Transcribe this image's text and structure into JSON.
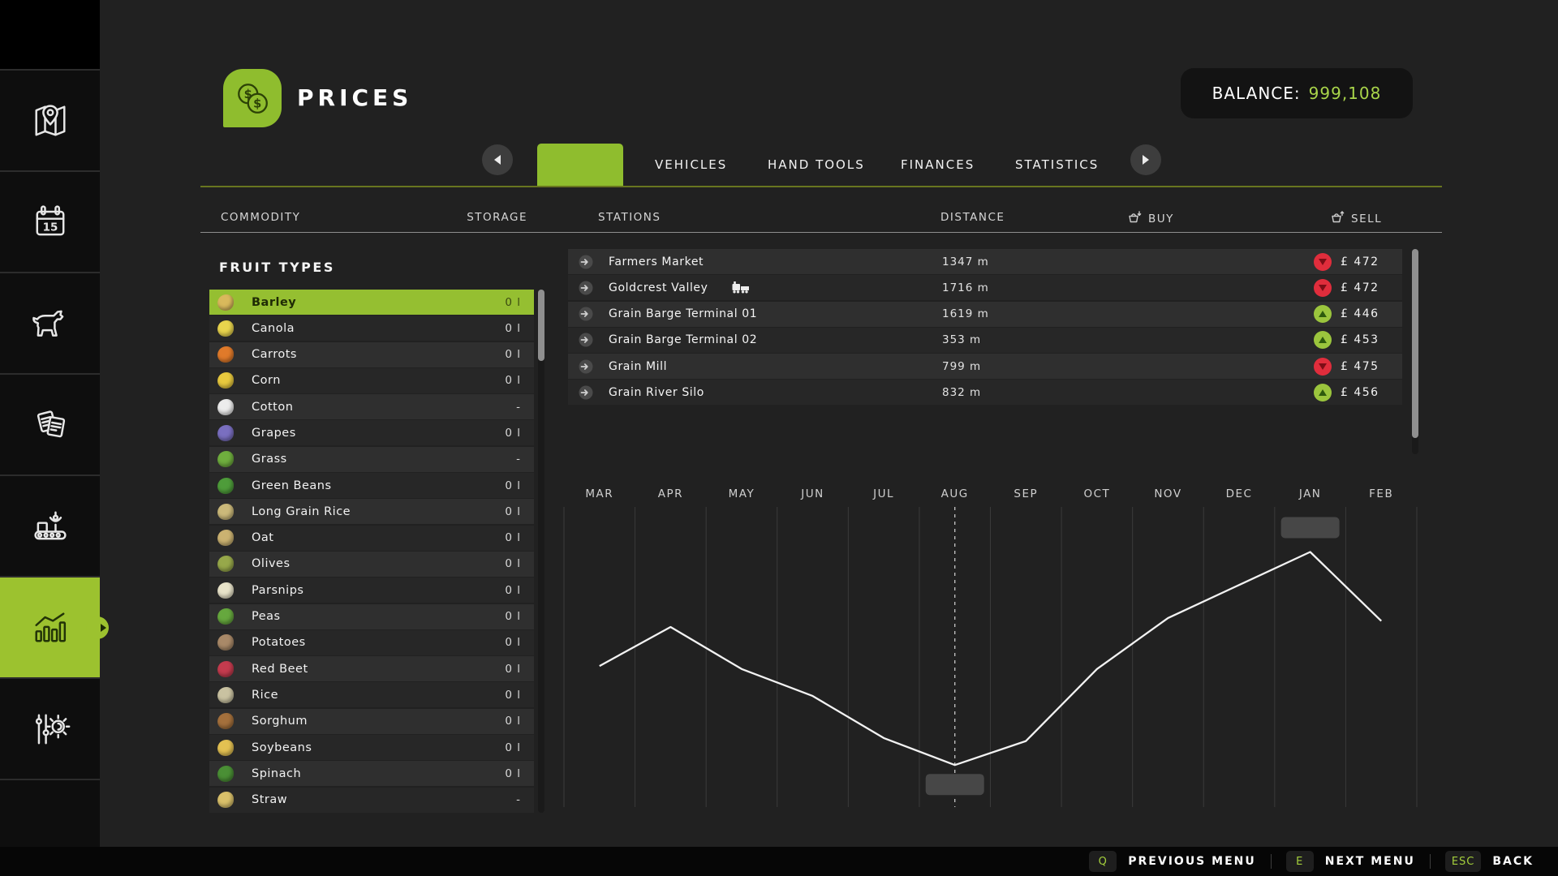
{
  "header": {
    "title": "PRICES",
    "coin_symbol": "$",
    "balance_label": "BALANCE:",
    "balance_value": "999,108"
  },
  "sidebar": {
    "calendar_day": "15",
    "items": [
      {
        "name": "map",
        "icon": "map-icon",
        "active": false
      },
      {
        "name": "calendar",
        "icon": "calendar-icon",
        "active": false
      },
      {
        "name": "animals",
        "icon": "cow-icon",
        "active": false
      },
      {
        "name": "contracts",
        "icon": "documents-icon",
        "active": false
      },
      {
        "name": "production",
        "icon": "conveyor-icon",
        "active": false
      },
      {
        "name": "statistics",
        "icon": "bar-chart-icon",
        "active": true
      },
      {
        "name": "settings",
        "icon": "sliders-gear-icon",
        "active": false
      }
    ]
  },
  "tabs": {
    "prev_icon": "chevron-left-icon",
    "next_icon": "chevron-right-icon",
    "active_label": "",
    "items": [
      "VEHICLES",
      "HAND TOOLS",
      "FINANCES",
      "STATISTICS"
    ]
  },
  "table_header": {
    "commodity": "COMMODITY",
    "storage": "STORAGE",
    "stations": "STATIONS",
    "distance": "DISTANCE",
    "buy": "BUY",
    "sell": "SELL",
    "buy_icon": "basket-arrow-down-icon",
    "sell_icon": "basket-arrow-up-icon"
  },
  "commodity_panel": {
    "title": "FRUIT TYPES",
    "items": [
      {
        "label": "Barley",
        "storage": "0 l",
        "selected": true,
        "icon": "barley-icon",
        "color": "#d9b95c"
      },
      {
        "label": "Canola",
        "storage": "0 l",
        "selected": false,
        "icon": "canola-icon",
        "color": "#e8d44d"
      },
      {
        "label": "Carrots",
        "storage": "0 l",
        "selected": false,
        "icon": "carrot-icon",
        "color": "#e07a2a"
      },
      {
        "label": "Corn",
        "storage": "0 l",
        "selected": false,
        "icon": "corn-icon",
        "color": "#e8c93e"
      },
      {
        "label": "Cotton",
        "storage": "-",
        "selected": false,
        "icon": "cotton-icon",
        "color": "#ececec"
      },
      {
        "label": "Grapes",
        "storage": "0 l",
        "selected": false,
        "icon": "grapes-icon",
        "color": "#7a6fc0"
      },
      {
        "label": "Grass",
        "storage": "-",
        "selected": false,
        "icon": "grass-icon",
        "color": "#6fae3e"
      },
      {
        "label": "Green Beans",
        "storage": "0 l",
        "selected": false,
        "icon": "green-beans-icon",
        "color": "#4e9c3a"
      },
      {
        "label": "Long Grain Rice",
        "storage": "0 l",
        "selected": false,
        "icon": "long-grain-rice-icon",
        "color": "#cbb97a"
      },
      {
        "label": "Oat",
        "storage": "0 l",
        "selected": false,
        "icon": "oat-icon",
        "color": "#cbb271"
      },
      {
        "label": "Olives",
        "storage": "0 l",
        "selected": false,
        "icon": "olives-icon",
        "color": "#97a84a"
      },
      {
        "label": "Parsnips",
        "storage": "0 l",
        "selected": false,
        "icon": "parsnip-icon",
        "color": "#e8e3c9"
      },
      {
        "label": "Peas",
        "storage": "0 l",
        "selected": false,
        "icon": "peas-icon",
        "color": "#66a83e"
      },
      {
        "label": "Potatoes",
        "storage": "0 l",
        "selected": false,
        "icon": "potato-icon",
        "color": "#a98968"
      },
      {
        "label": "Red Beet",
        "storage": "0 l",
        "selected": false,
        "icon": "red-beet-icon",
        "color": "#c43b4e"
      },
      {
        "label": "Rice",
        "storage": "0 l",
        "selected": false,
        "icon": "rice-icon",
        "color": "#c9c2a1"
      },
      {
        "label": "Sorghum",
        "storage": "0 l",
        "selected": false,
        "icon": "sorghum-icon",
        "color": "#a4703c"
      },
      {
        "label": "Soybeans",
        "storage": "0 l",
        "selected": false,
        "icon": "soybeans-icon",
        "color": "#e3c152"
      },
      {
        "label": "Spinach",
        "storage": "0 l",
        "selected": false,
        "icon": "spinach-icon",
        "color": "#4a8f35"
      },
      {
        "label": "Straw",
        "storage": "-",
        "selected": false,
        "icon": "straw-icon",
        "color": "#d9c06a"
      }
    ]
  },
  "stations": [
    {
      "name": "Farmers Market",
      "train": false,
      "distance": "1347 m",
      "trend": "down",
      "price": "£ 472"
    },
    {
      "name": "Goldcrest Valley",
      "train": true,
      "distance": "1716 m",
      "trend": "down",
      "price": "£ 472"
    },
    {
      "name": "Grain Barge Terminal 01",
      "train": false,
      "distance": "1619 m",
      "trend": "up",
      "price": "£ 446"
    },
    {
      "name": "Grain Barge Terminal 02",
      "train": false,
      "distance": "353 m",
      "trend": "up",
      "price": "£ 453"
    },
    {
      "name": "Grain Mill",
      "train": false,
      "distance": "799 m",
      "trend": "down",
      "price": "£ 475"
    },
    {
      "name": "Grain River Silo",
      "train": false,
      "distance": "832 m",
      "trend": "up",
      "price": "£ 456"
    }
  ],
  "chart_data": {
    "type": "line",
    "title": "",
    "xlabel": "",
    "ylabel": "",
    "x": [
      "MAR",
      "APR",
      "MAY",
      "JUN",
      "JUL",
      "AUG",
      "SEP",
      "OCT",
      "NOV",
      "DEC",
      "JAN",
      "FEB"
    ],
    "values": [
      0.47,
      0.6,
      0.46,
      0.37,
      0.23,
      0.14,
      0.22,
      0.46,
      0.63,
      0.74,
      0.85,
      0.62
    ],
    "values_scale": "relative 0-1, y axis not labeled in game",
    "ylim": [
      0,
      1
    ],
    "grid": "vertical lines at month boundaries",
    "legend": "none",
    "cursor_month": "AUG",
    "markers": [
      {
        "month": "JAN",
        "pos": "above",
        "label": ""
      },
      {
        "month": "AUG",
        "pos": "below",
        "label": ""
      }
    ],
    "line_color": "#f2f2f2"
  },
  "footer": {
    "shortcuts": [
      {
        "key": "Q",
        "label": "PREVIOUS MENU"
      },
      {
        "key": "E",
        "label": "NEXT MENU"
      },
      {
        "key": "ESC",
        "label": "BACK"
      }
    ]
  },
  "colors": {
    "accent_green": "#8fbd2e",
    "sidebar_active": "#9cc22f",
    "selected_row": "#95bf31",
    "balance_value": "#a9d54a",
    "trend_up": "#9bc53d",
    "trend_down": "#e02d3c"
  }
}
